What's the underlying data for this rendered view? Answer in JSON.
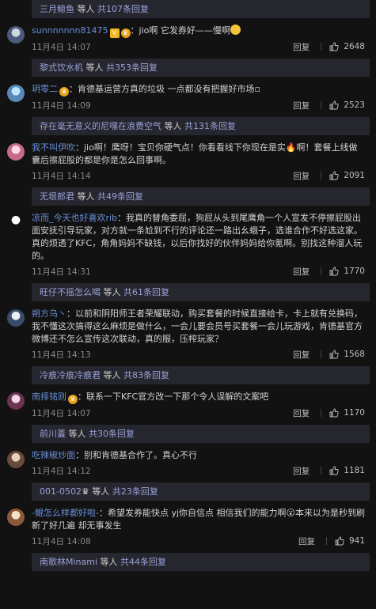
{
  "reply_label": "回复",
  "rows": [
    {
      "kind": "bar",
      "user": "三月鲸鱼",
      "middle": " 等人 ",
      "tail": "共107条回复"
    },
    {
      "kind": "comment",
      "avatar": [
        "#cfd6e0",
        "#4b5a7c"
      ],
      "nick": "sunnnnnnn81475",
      "badges": [
        "V",
        "♛"
      ],
      "text": "：jio啊 它发券好——慢啊",
      "emoji": true,
      "time": "11月4日 14:07",
      "likes": "2648"
    },
    {
      "kind": "bar",
      "user": "黎式饮水机",
      "middle": " 等人 ",
      "tail": "共353条回复"
    },
    {
      "kind": "comment",
      "avatar": [
        "#bfe6ff",
        "#5a88b8"
      ],
      "nick": "玥零二",
      "badges": [
        "♛"
      ],
      "text": "：肯德基运营方真的垃圾  一点都没有把握好市场▫",
      "emoji": false,
      "time": "11月4日 14:09",
      "likes": "2523"
    },
    {
      "kind": "bar",
      "user": "存在毫无意义的尼嘿在浪费空气",
      "middle": " 等人 ",
      "tail": "共131条回复"
    },
    {
      "kind": "comment",
      "avatar": [
        "#ffd9e4",
        "#c56a8a"
      ],
      "nick": "我不叫伊吹",
      "badges": [],
      "text": "：jio啊！鹰呀！宝贝你硬气点！你看看线下你现在是实🔥啊！套餐上线做囊后擦屁股的都是你是怎么回事啊。",
      "emoji": false,
      "time": "11月4日 14:14",
      "likes": "2091"
    },
    {
      "kind": "bar",
      "user": "无垠郎君",
      "middle": " 等人 ",
      "tail": "共49条回复"
    },
    {
      "kind": "comment",
      "avatar": [
        "#ffffff",
        "#111111"
      ],
      "nick": "凉而_今天也好喜欢rib",
      "badges": [],
      "text": "：我真的替角委屈，狗屁从头到尾鹰角一个人宣发不停擦屁股出面安抚引导玩家，对方就一条尬到不行的评论还一路出幺蛾子，选谁合作不好选这家。真的烦透了KFC，角角妈妈不缺钱，以后你找好的伙伴妈妈给你氪啊。别找这种溜人玩的。",
      "emoji": false,
      "time": "11月4日 14:31",
      "likes": "1770"
    },
    {
      "kind": "bar",
      "user": "旺仔不摇怎么喝",
      "middle": " 等人 ",
      "tail": "共61条回复"
    },
    {
      "kind": "comment",
      "avatar": [
        "#e8eef5",
        "#3b4b6b"
      ],
      "nick": "朔方乌丶",
      "badges": [],
      "text": "：以前和阴阳师王者荣耀联动，购买套餐的时候直接给卡，卡上就有兑换码，我不懂这次搞得这么麻烦是做什么，一会儿要会员号买套餐一会儿玩游戏，肯德基官方微博还不怎么宣传这次联动，真的服，压榨玩家？",
      "emoji": false,
      "time": "11月4日 14:13",
      "likes": "1568"
    },
    {
      "kind": "bar",
      "user": "冷痕冷痕冷痕君",
      "middle": " 等人 ",
      "tail": "共83条回复"
    },
    {
      "kind": "comment",
      "avatar": [
        "#f3d7e6",
        "#6b3450"
      ],
      "nick": "南择铭则",
      "badges": [
        "♛"
      ],
      "text": "：联系一下KFC官方改一下那个令人误解的文案吧",
      "emoji": false,
      "time": "11月4日 14:07",
      "likes": "1170"
    },
    {
      "kind": "bar",
      "user": "前川蓋",
      "middle": " 等人 ",
      "tail": "共30条回复"
    },
    {
      "kind": "comment",
      "avatar": [
        "#e6d2c0",
        "#6a4a38"
      ],
      "nick": "吃辣椒炒面",
      "badges": [],
      "text": "：别和肯德基合作了。真心不行",
      "emoji": false,
      "time": "11月4日 14:12",
      "likes": "1181"
    },
    {
      "kind": "bar",
      "user": "001-0502",
      "middle": "♛ 等人 ",
      "tail": "共23条回复"
    },
    {
      "kind": "comment",
      "avatar": [
        "#f5e3c8",
        "#8a5a3a"
      ],
      "nick": "-鲲怎么样都好啦-",
      "badges": [],
      "text": "：希望发券能快点 yj你自信点 相信我们的能力啊😮本来以为是秒到刷新了好几遍 却无事发生",
      "emoji": false,
      "time": "11月4日 14:08",
      "likes": "941"
    },
    {
      "kind": "bar",
      "user": "南歌林Minami",
      "middle": " 等人 ",
      "tail": "共44条回复"
    }
  ]
}
